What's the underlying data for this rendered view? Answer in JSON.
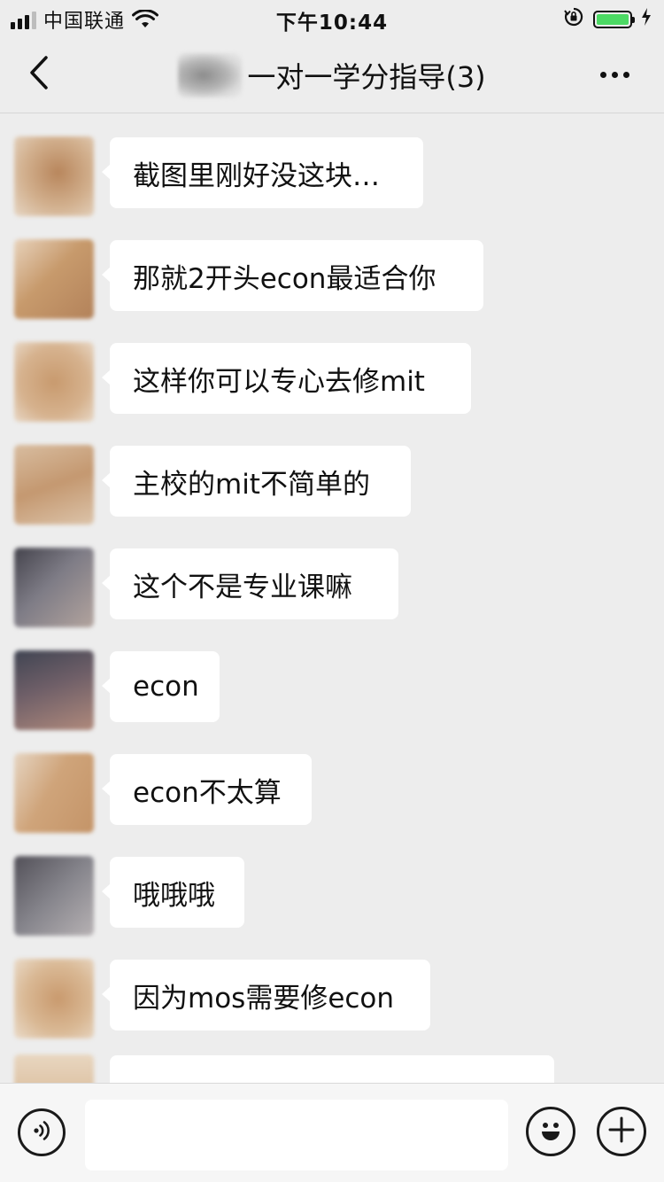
{
  "status_bar": {
    "carrier": "中国联通",
    "time": "下午10:44",
    "icons": [
      "signal-icon",
      "wifi-icon",
      "orientation-lock-icon",
      "battery-icon",
      "charging-icon"
    ],
    "battery_level": 1.0,
    "battery_color": "#4cd964"
  },
  "nav": {
    "back_icon": "chevron-left-icon",
    "title": "一对一学分指导(3)",
    "more_icon": "more-dots-icon"
  },
  "messages": [
    {
      "text": "截图里刚好没这块…",
      "avatar_color": "#c29a78"
    },
    {
      "text": "那就2开头econ最适合你",
      "avatar_color": "#c49a72"
    },
    {
      "text": "这样你可以专心去修mit",
      "avatar_color": "#c89e7c"
    },
    {
      "text": "主校的mit不简单的",
      "avatar_color": "#c39b78"
    },
    {
      "text": "这个不是专业课嘛",
      "avatar_color": "#6f6f78"
    },
    {
      "text": "econ",
      "avatar_color": "#7a6a72"
    },
    {
      "text": "econ不太算",
      "avatar_color": "#c8a078"
    },
    {
      "text": "哦哦哦",
      "avatar_color": "#77777c"
    },
    {
      "text": "因为mos需要修econ",
      "avatar_color": "#c9a07a"
    },
    {
      "text": "",
      "avatar_color": "#d6b48f"
    }
  ],
  "input_bar": {
    "voice_icon": "voice-icon",
    "input_value": "",
    "emoji_icon": "emoji-icon",
    "plus_icon": "plus-icon"
  },
  "colors": {
    "background": "#ededed",
    "bubble": "#ffffff",
    "input_bar": "#f6f6f6"
  }
}
